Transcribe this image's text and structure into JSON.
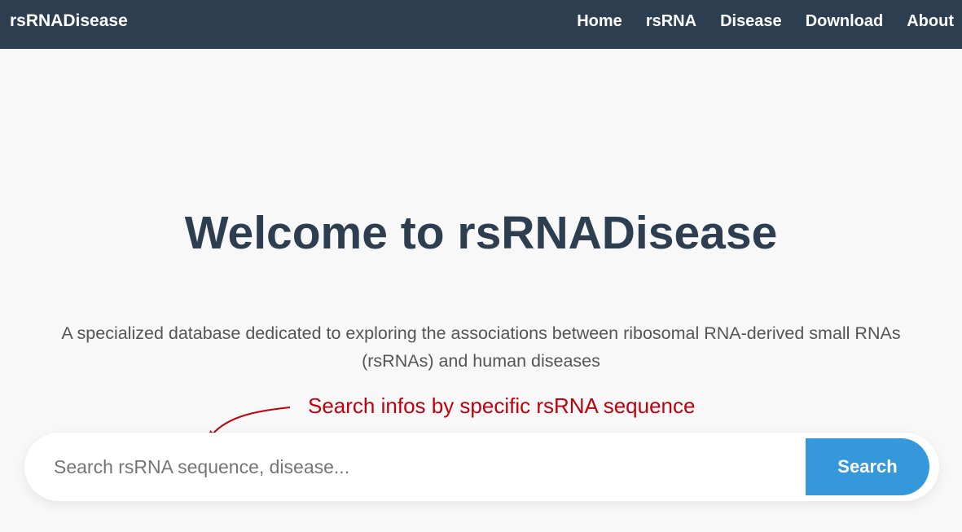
{
  "navbar": {
    "brand": "rsRNADisease",
    "links": [
      {
        "label": "Home"
      },
      {
        "label": "rsRNA"
      },
      {
        "label": "Disease"
      },
      {
        "label": "Download"
      },
      {
        "label": "About"
      }
    ]
  },
  "hero": {
    "title": "Welcome to rsRNADisease",
    "subtitle": "A specialized database dedicated to exploring the associations between ribosomal RNA-derived small RNAs (rsRNAs) and human diseases"
  },
  "annotation": {
    "text": "Search infos by specific rsRNA sequence",
    "color": "#c0000c"
  },
  "search": {
    "placeholder": "Search rsRNA sequence, disease...",
    "value": "",
    "button_label": "Search"
  },
  "colors": {
    "navbar_bg": "#2c3e50",
    "accent": "#3498db",
    "title": "#2c3e50",
    "page_bg": "#f8f8f8"
  }
}
